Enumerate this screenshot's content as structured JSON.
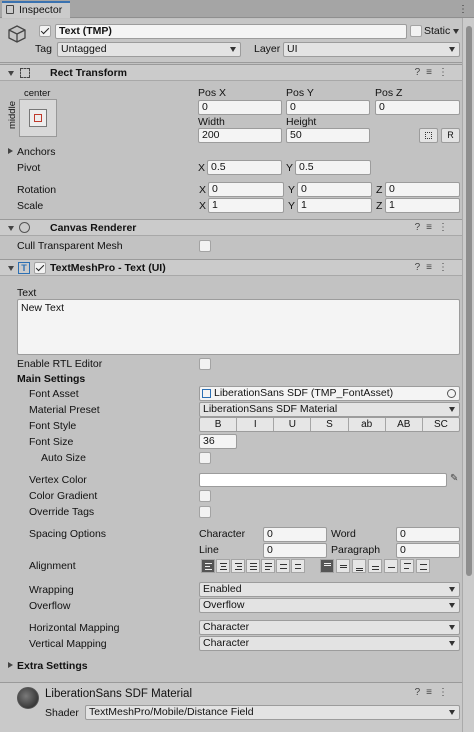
{
  "tab": {
    "title": "Inspector"
  },
  "object": {
    "name": "Text (TMP)",
    "static_label": "Static",
    "tag_label": "Tag",
    "tag_value": "Untagged",
    "layer_label": "Layer",
    "layer_value": "UI"
  },
  "rect": {
    "title": "Rect Transform",
    "anchor_h": "center",
    "anchor_v": "middle",
    "posx_label": "Pos X",
    "posy_label": "Pos Y",
    "posz_label": "Pos Z",
    "posx": "0",
    "posy": "0",
    "posz": "0",
    "width_label": "Width",
    "height_label": "Height",
    "width": "200",
    "height": "50",
    "r_btn": "R",
    "anchors_label": "Anchors",
    "pivot_label": "Pivot",
    "pivot_x": "0.5",
    "pivot_y": "0.5",
    "rotation_label": "Rotation",
    "rot_x": "0",
    "rot_y": "0",
    "rot_z": "0",
    "scale_label": "Scale",
    "scale_x": "1",
    "scale_y": "1",
    "scale_z": "1",
    "x": "X",
    "y": "Y",
    "z": "Z"
  },
  "canvas": {
    "title": "Canvas Renderer",
    "cull_label": "Cull Transparent Mesh"
  },
  "tmp": {
    "title": "TextMeshPro - Text (UI)",
    "text_label": "Text",
    "text_value": "New Text",
    "rtl_label": "Enable RTL Editor",
    "main_settings": "Main Settings",
    "font_asset_label": "Font Asset",
    "font_asset_value": "LiberationSans SDF (TMP_FontAsset)",
    "material_preset_label": "Material Preset",
    "material_preset_value": "LiberationSans SDF Material",
    "font_style_label": "Font Style",
    "styles": [
      "B",
      "I",
      "U",
      "S",
      "ab",
      "AB",
      "SC"
    ],
    "font_size_label": "Font Size",
    "font_size_value": "36",
    "auto_size_label": "Auto Size",
    "vertex_color_label": "Vertex Color",
    "color_gradient_label": "Color Gradient",
    "override_tags_label": "Override Tags",
    "spacing_label": "Spacing Options",
    "character_label": "Character",
    "character_value": "0",
    "word_label": "Word",
    "word_value": "0",
    "line_label": "Line",
    "line_value": "0",
    "paragraph_label": "Paragraph",
    "paragraph_value": "0",
    "alignment_label": "Alignment",
    "wrapping_label": "Wrapping",
    "wrapping_value": "Enabled",
    "overflow_label": "Overflow",
    "overflow_value": "Overflow",
    "hmap_label": "Horizontal Mapping",
    "hmap_value": "Character",
    "vmap_label": "Vertical Mapping",
    "vmap_value": "Character",
    "extra_label": "Extra Settings"
  },
  "material": {
    "name": "LiberationSans SDF Material",
    "shader_label": "Shader",
    "shader_value": "TextMeshPro/Mobile/Distance Field"
  },
  "colors": {
    "panel": "#c2c2c2",
    "header": "#cbcbcb",
    "field": "#f4f4f4",
    "selected": "#555555"
  }
}
